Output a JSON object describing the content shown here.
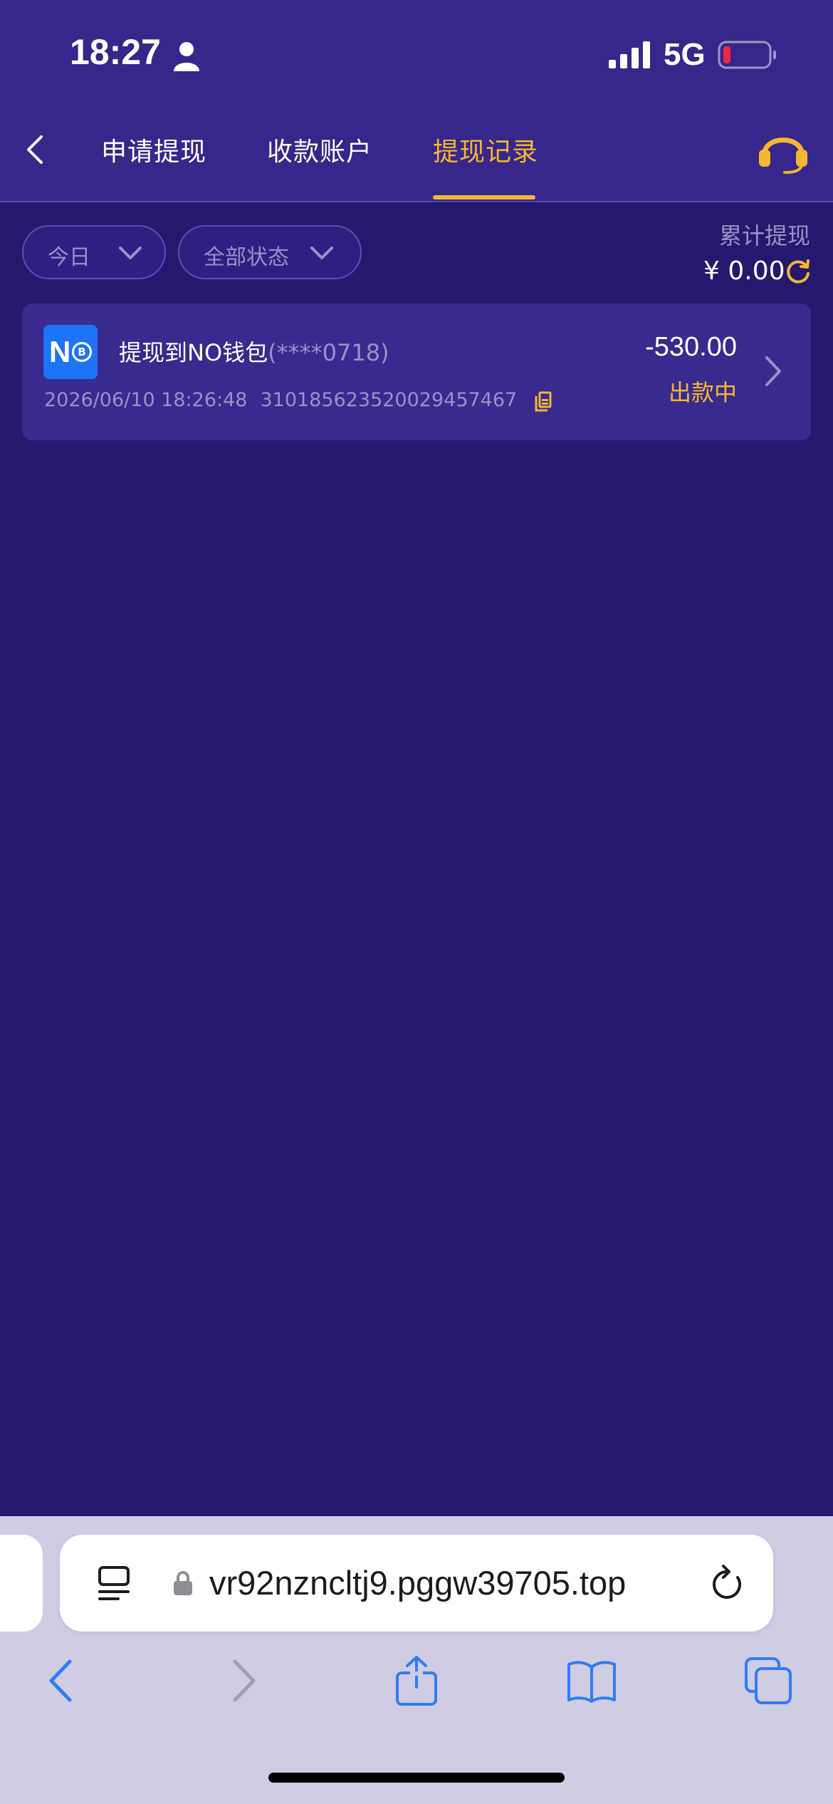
{
  "status_bar": {
    "time": "18:27",
    "network": "5G",
    "icons": [
      "person-icon",
      "signal-bars-icon",
      "battery-low-icon"
    ]
  },
  "nav": {
    "tabs": [
      {
        "label": "申请提现",
        "active": false
      },
      {
        "label": "收款账户",
        "active": false
      },
      {
        "label": "提现记录",
        "active": true
      }
    ],
    "icons": [
      "back-chevron-icon",
      "customer-service-headset-icon"
    ]
  },
  "filters": {
    "date": "今日",
    "status": "全部状态"
  },
  "summary": {
    "label": "累计提现",
    "amount": "¥ 0.00"
  },
  "records": [
    {
      "title": "提现到NO钱包",
      "account": "(****0718)",
      "datetime": "2026/06/10 18:26:48",
      "order_no": "31018562352002945746​7",
      "amount": "-530.00",
      "status": "出款中",
      "logo_text": "N"
    }
  ],
  "browser": {
    "url": "vr92nzncltj9.pggw39705.top"
  },
  "colors": {
    "background": "#25186F",
    "header": "#37278A",
    "accent": "#F5B731",
    "card": "#382A8E",
    "muted_text": "#9A92C9",
    "wallet_blue": "#1E74F6",
    "browser_blue": "#2F7CF6"
  }
}
